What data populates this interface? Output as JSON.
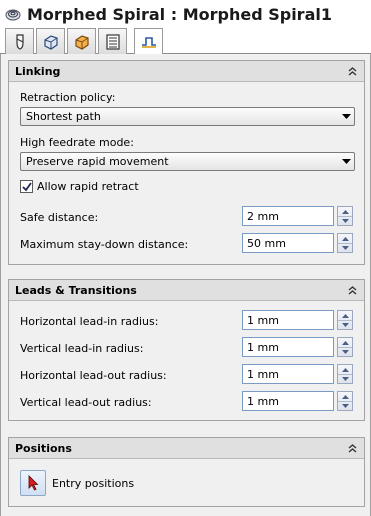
{
  "window": {
    "title": "Morphed Spiral : Morphed Spiral1"
  },
  "tabs": [
    {
      "icon": "tool-icon",
      "active": false
    },
    {
      "icon": "boundary-icon",
      "active": false
    },
    {
      "icon": "geometry-icon",
      "active": false
    },
    {
      "icon": "passes-icon",
      "active": false
    },
    {
      "icon": "linking-icon",
      "active": true
    }
  ],
  "linking": {
    "header": "Linking",
    "retraction_policy_label": "Retraction policy:",
    "retraction_policy_value": "Shortest path",
    "high_feedrate_label": "High feedrate mode:",
    "high_feedrate_value": "Preserve rapid movement",
    "allow_rapid_retract_label": "Allow rapid retract",
    "allow_rapid_retract_checked": true,
    "safe_distance_label": "Safe distance:",
    "safe_distance_value": "2 mm",
    "stay_down_label": "Maximum stay-down distance:",
    "stay_down_value": "50 mm"
  },
  "leads": {
    "header": "Leads & Transitions",
    "h_lead_in_label": "Horizontal lead-in radius:",
    "h_lead_in_value": "1 mm",
    "v_lead_in_label": "Vertical lead-in radius:",
    "v_lead_in_value": "1 mm",
    "h_lead_out_label": "Horizontal lead-out radius:",
    "h_lead_out_value": "1 mm",
    "v_lead_out_label": "Vertical lead-out radius:",
    "v_lead_out_value": "1 mm"
  },
  "positions": {
    "header": "Positions",
    "entry_positions_label": "Entry positions"
  },
  "colors": {
    "panel_bg": "#f0f0f0",
    "header_bg": "#e0e0e0",
    "input_border": "#7a9cc4",
    "accent_red": "#d22020"
  }
}
